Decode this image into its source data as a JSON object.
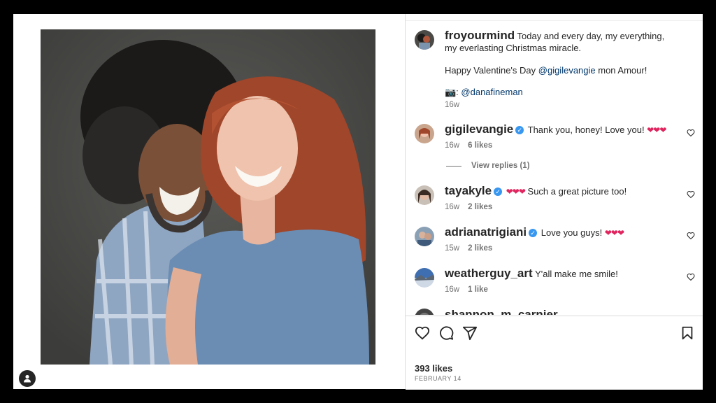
{
  "post": {
    "author": "froyourmind",
    "caption_line1": "Today and every day, my everything, my everlasting Christmas miracle.",
    "caption_line2_prefix": "Happy Valentine's Day ",
    "caption_line2_mention": "@gigilevangie",
    "caption_line2_suffix": " mon Amour!",
    "caption_line3_prefix": "📷: ",
    "caption_line3_mention": "@danafineman",
    "time": "16w"
  },
  "comments": [
    {
      "user": "gigilevangie",
      "verified": true,
      "hearts_before": "",
      "text": "Thank you, honey! Love you! ",
      "hearts_after": "❤❤❤",
      "time": "16w",
      "likes": "6 likes"
    },
    {
      "user": "tayakyle",
      "verified": true,
      "hearts_before": "❤❤❤",
      "text": " Such a great picture too!",
      "hearts_after": "",
      "time": "16w",
      "likes": "2 likes"
    },
    {
      "user": "adrianatrigiani",
      "verified": true,
      "hearts_before": "",
      "text": "Love you guys! ",
      "hearts_after": "❤❤❤",
      "time": "15w",
      "likes": "2 likes"
    },
    {
      "user": "weatherguy_art",
      "verified": false,
      "hearts_before": "",
      "text": "Y'all make me smile!",
      "hearts_after": "",
      "time": "16w",
      "likes": "1 like"
    },
    {
      "user": "shannon_m_carnier",
      "partial": true
    }
  ],
  "view_replies": "View replies (1)",
  "footer": {
    "likes": "393 likes",
    "date": "FEBRUARY 14"
  },
  "icons": {
    "like": "heart-icon",
    "comment": "comment-icon",
    "share": "paper-plane-icon",
    "save": "bookmark-icon",
    "profile": "user-icon"
  },
  "colors": {
    "mention": "#00376b",
    "verified": "#3897f0",
    "hearts": "#e0245e",
    "secondary_text": "#737373"
  }
}
